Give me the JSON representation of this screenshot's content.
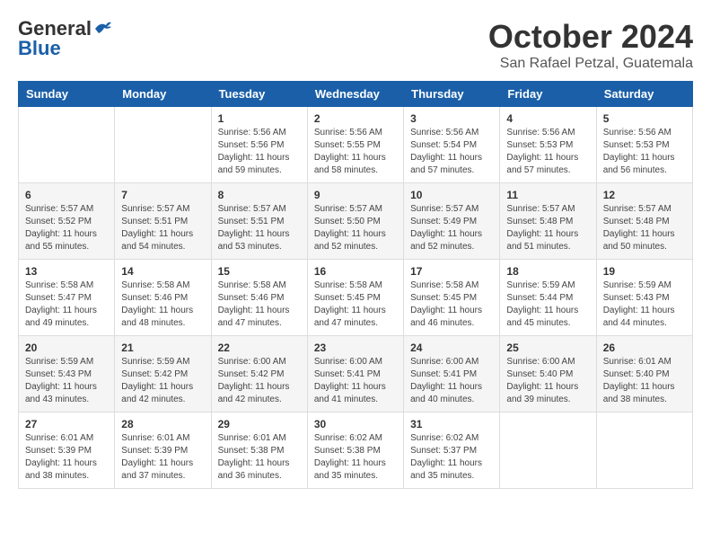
{
  "header": {
    "logo_general": "General",
    "logo_blue": "Blue",
    "month_title": "October 2024",
    "location": "San Rafael Petzal, Guatemala"
  },
  "days_of_week": [
    "Sunday",
    "Monday",
    "Tuesday",
    "Wednesday",
    "Thursday",
    "Friday",
    "Saturday"
  ],
  "weeks": [
    [
      {
        "day": null,
        "data": null
      },
      {
        "day": null,
        "data": null
      },
      {
        "day": "1",
        "data": "Sunrise: 5:56 AM\nSunset: 5:56 PM\nDaylight: 11 hours and 59 minutes."
      },
      {
        "day": "2",
        "data": "Sunrise: 5:56 AM\nSunset: 5:55 PM\nDaylight: 11 hours and 58 minutes."
      },
      {
        "day": "3",
        "data": "Sunrise: 5:56 AM\nSunset: 5:54 PM\nDaylight: 11 hours and 57 minutes."
      },
      {
        "day": "4",
        "data": "Sunrise: 5:56 AM\nSunset: 5:53 PM\nDaylight: 11 hours and 57 minutes."
      },
      {
        "day": "5",
        "data": "Sunrise: 5:56 AM\nSunset: 5:53 PM\nDaylight: 11 hours and 56 minutes."
      }
    ],
    [
      {
        "day": "6",
        "data": "Sunrise: 5:57 AM\nSunset: 5:52 PM\nDaylight: 11 hours and 55 minutes."
      },
      {
        "day": "7",
        "data": "Sunrise: 5:57 AM\nSunset: 5:51 PM\nDaylight: 11 hours and 54 minutes."
      },
      {
        "day": "8",
        "data": "Sunrise: 5:57 AM\nSunset: 5:51 PM\nDaylight: 11 hours and 53 minutes."
      },
      {
        "day": "9",
        "data": "Sunrise: 5:57 AM\nSunset: 5:50 PM\nDaylight: 11 hours and 52 minutes."
      },
      {
        "day": "10",
        "data": "Sunrise: 5:57 AM\nSunset: 5:49 PM\nDaylight: 11 hours and 52 minutes."
      },
      {
        "day": "11",
        "data": "Sunrise: 5:57 AM\nSunset: 5:48 PM\nDaylight: 11 hours and 51 minutes."
      },
      {
        "day": "12",
        "data": "Sunrise: 5:57 AM\nSunset: 5:48 PM\nDaylight: 11 hours and 50 minutes."
      }
    ],
    [
      {
        "day": "13",
        "data": "Sunrise: 5:58 AM\nSunset: 5:47 PM\nDaylight: 11 hours and 49 minutes."
      },
      {
        "day": "14",
        "data": "Sunrise: 5:58 AM\nSunset: 5:46 PM\nDaylight: 11 hours and 48 minutes."
      },
      {
        "day": "15",
        "data": "Sunrise: 5:58 AM\nSunset: 5:46 PM\nDaylight: 11 hours and 47 minutes."
      },
      {
        "day": "16",
        "data": "Sunrise: 5:58 AM\nSunset: 5:45 PM\nDaylight: 11 hours and 47 minutes."
      },
      {
        "day": "17",
        "data": "Sunrise: 5:58 AM\nSunset: 5:45 PM\nDaylight: 11 hours and 46 minutes."
      },
      {
        "day": "18",
        "data": "Sunrise: 5:59 AM\nSunset: 5:44 PM\nDaylight: 11 hours and 45 minutes."
      },
      {
        "day": "19",
        "data": "Sunrise: 5:59 AM\nSunset: 5:43 PM\nDaylight: 11 hours and 44 minutes."
      }
    ],
    [
      {
        "day": "20",
        "data": "Sunrise: 5:59 AM\nSunset: 5:43 PM\nDaylight: 11 hours and 43 minutes."
      },
      {
        "day": "21",
        "data": "Sunrise: 5:59 AM\nSunset: 5:42 PM\nDaylight: 11 hours and 42 minutes."
      },
      {
        "day": "22",
        "data": "Sunrise: 6:00 AM\nSunset: 5:42 PM\nDaylight: 11 hours and 42 minutes."
      },
      {
        "day": "23",
        "data": "Sunrise: 6:00 AM\nSunset: 5:41 PM\nDaylight: 11 hours and 41 minutes."
      },
      {
        "day": "24",
        "data": "Sunrise: 6:00 AM\nSunset: 5:41 PM\nDaylight: 11 hours and 40 minutes."
      },
      {
        "day": "25",
        "data": "Sunrise: 6:00 AM\nSunset: 5:40 PM\nDaylight: 11 hours and 39 minutes."
      },
      {
        "day": "26",
        "data": "Sunrise: 6:01 AM\nSunset: 5:40 PM\nDaylight: 11 hours and 38 minutes."
      }
    ],
    [
      {
        "day": "27",
        "data": "Sunrise: 6:01 AM\nSunset: 5:39 PM\nDaylight: 11 hours and 38 minutes."
      },
      {
        "day": "28",
        "data": "Sunrise: 6:01 AM\nSunset: 5:39 PM\nDaylight: 11 hours and 37 minutes."
      },
      {
        "day": "29",
        "data": "Sunrise: 6:01 AM\nSunset: 5:38 PM\nDaylight: 11 hours and 36 minutes."
      },
      {
        "day": "30",
        "data": "Sunrise: 6:02 AM\nSunset: 5:38 PM\nDaylight: 11 hours and 35 minutes."
      },
      {
        "day": "31",
        "data": "Sunrise: 6:02 AM\nSunset: 5:37 PM\nDaylight: 11 hours and 35 minutes."
      },
      {
        "day": null,
        "data": null
      },
      {
        "day": null,
        "data": null
      }
    ]
  ]
}
